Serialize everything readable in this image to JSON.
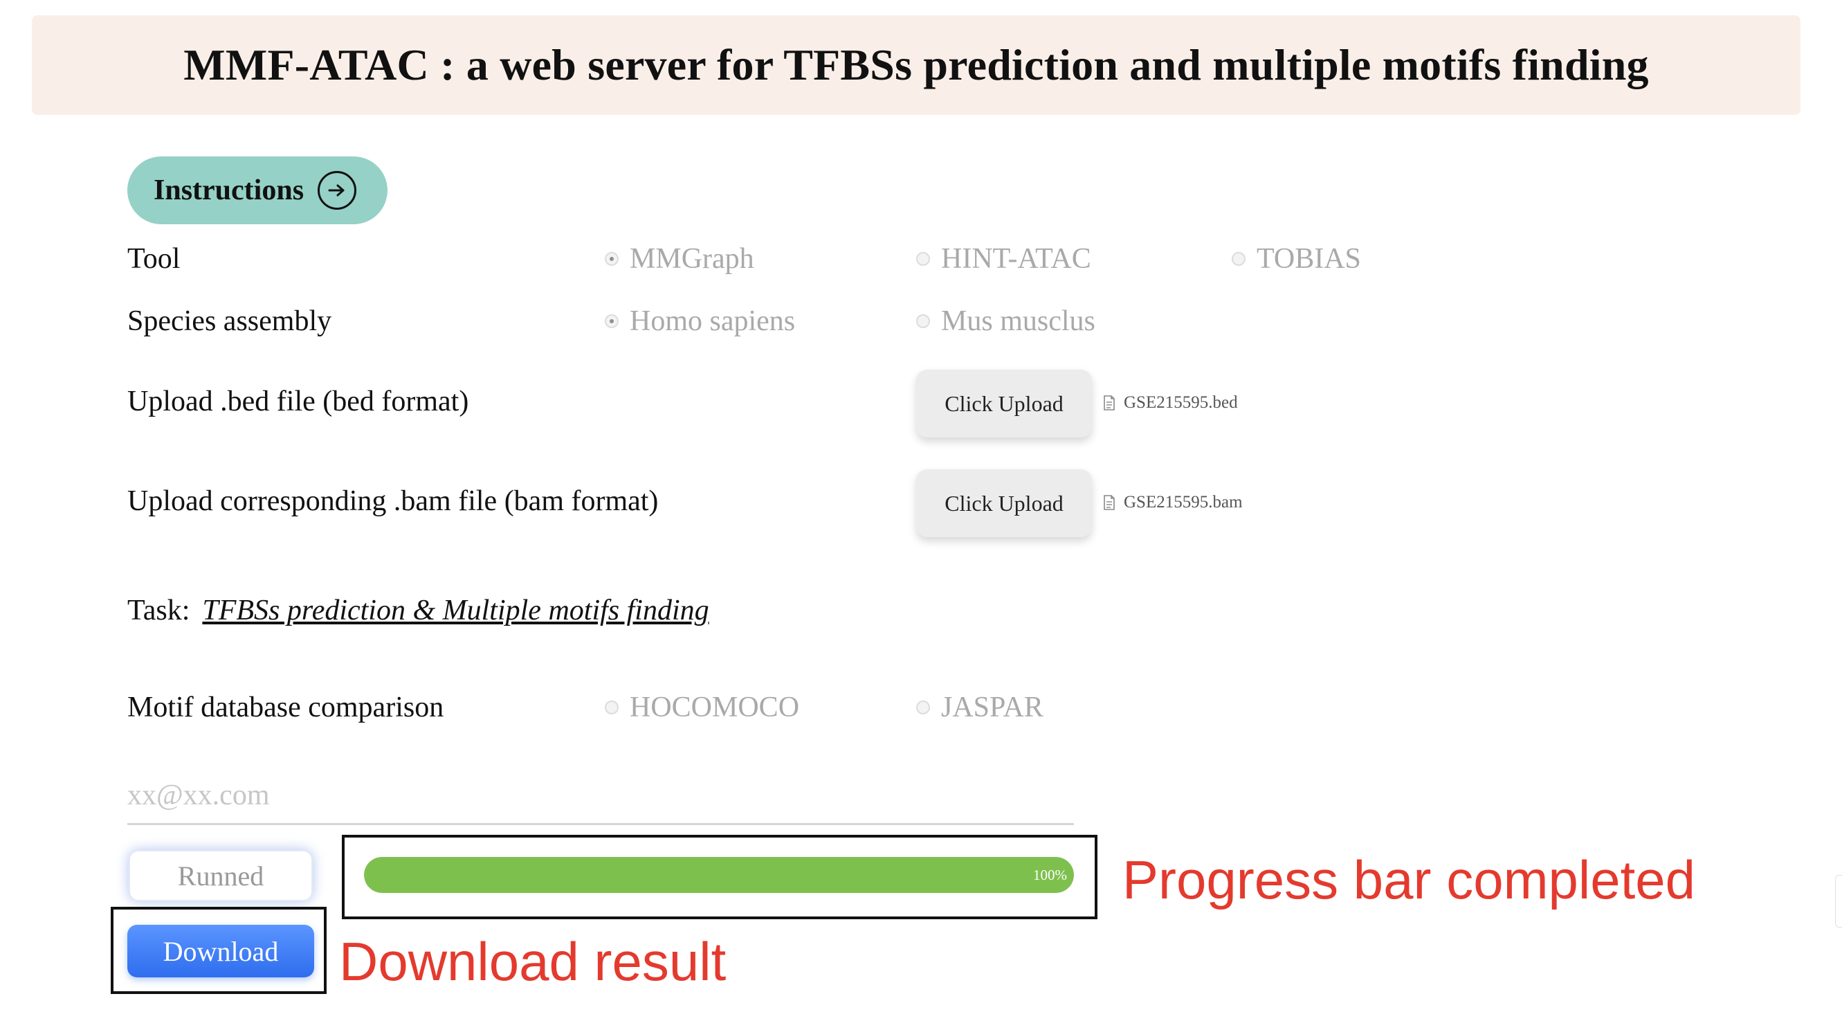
{
  "header": {
    "title": "MMF-ATAC : a web server for TFBSs prediction and multiple motifs finding"
  },
  "instructions": {
    "label": "Instructions",
    "icon": "arrow-right-circle-icon"
  },
  "form": {
    "tool": {
      "label": "Tool",
      "options": [
        "MMGraph",
        "HINT-ATAC",
        "TOBIAS"
      ],
      "selected": "MMGraph"
    },
    "species": {
      "label": "Species assembly",
      "options": [
        "Homo sapiens",
        "Mus musclus"
      ],
      "selected": "Homo sapiens"
    },
    "bed_upload": {
      "label": "Upload .bed file (bed format)",
      "button": "Click Upload",
      "file": "GSE215595.bed"
    },
    "bam_upload": {
      "label": "Upload corresponding .bam file (bam format)",
      "button": "Click Upload",
      "file": "GSE215595.bam"
    },
    "task": {
      "label": "Task:",
      "value": "TFBSs prediction & Multiple motifs finding"
    },
    "motif_db": {
      "label": "Motif database comparison",
      "options": [
        "HOCOMOCO",
        "JASPAR"
      ],
      "selected": null
    },
    "email": {
      "placeholder": "xx@xx.com",
      "value": ""
    }
  },
  "actions": {
    "runned_label": "Runned",
    "download_label": "Download"
  },
  "progress": {
    "value": 100,
    "text": "100%",
    "color": "#7ec04e"
  },
  "annotations": {
    "progress": "Progress bar completed",
    "download": "Download result",
    "color": "#e43a2e"
  }
}
